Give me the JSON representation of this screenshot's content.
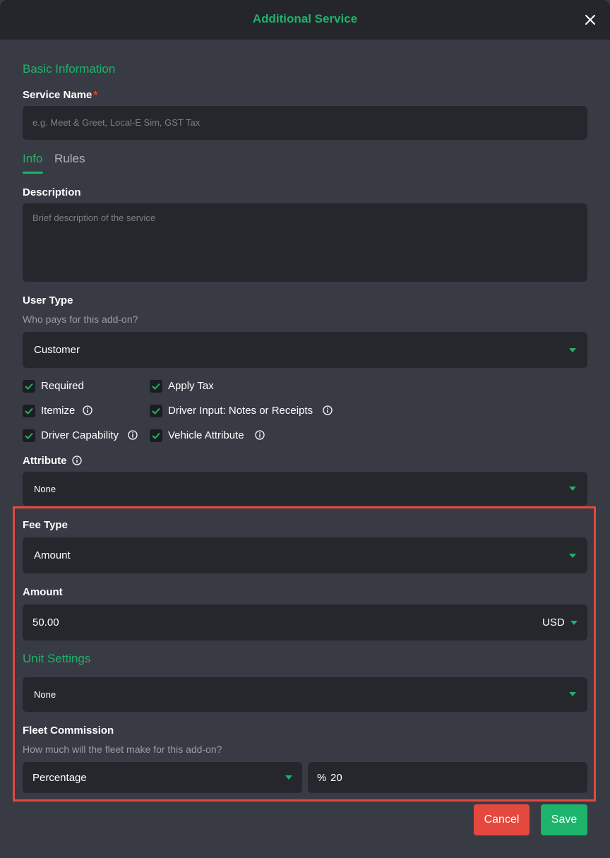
{
  "header": {
    "title": "Additional Service"
  },
  "basic_info": {
    "section_title": "Basic Information",
    "service_name_label": "Service Name",
    "required_mark": "*",
    "service_name_placeholder": "e.g. Meet & Greet, Local-E Sim, GST Tax"
  },
  "tabs": [
    {
      "label": "Info",
      "active": true
    },
    {
      "label": "Rules",
      "active": false
    }
  ],
  "description": {
    "label": "Description",
    "placeholder": "Brief description of the service"
  },
  "user_type": {
    "label": "User Type",
    "hint": "Who pays for this add-on?",
    "value": "Customer"
  },
  "checkboxes": [
    {
      "label": "Required",
      "checked": true,
      "info": false
    },
    {
      "label": "Apply Tax",
      "checked": true,
      "info": false
    },
    {
      "label": "Itemize",
      "checked": true,
      "info": true
    },
    {
      "label": "Driver Input: Notes or Receipts",
      "checked": true,
      "info": true
    },
    {
      "label": "Driver Capability",
      "checked": true,
      "info": true
    },
    {
      "label": "Vehicle Attribute",
      "checked": true,
      "info": true
    }
  ],
  "attribute": {
    "label": "Attribute",
    "value": "None"
  },
  "fee_type": {
    "label": "Fee Type",
    "value": "Amount"
  },
  "amount": {
    "label": "Amount",
    "value": "50.00",
    "currency": "USD"
  },
  "unit_settings": {
    "section_title": "Unit Settings",
    "value": "None"
  },
  "fleet_commission": {
    "label": "Fleet Commission",
    "hint": "How much will the fleet make for this add-on?",
    "type_value": "Percentage",
    "prefix": "%",
    "value": "20"
  },
  "buttons": {
    "cancel": "Cancel",
    "save": "Save"
  },
  "colors": {
    "accent": "#1db36b",
    "danger": "#e5483f",
    "background": "#383b43",
    "field": "#25272d",
    "header": "#24262c"
  }
}
